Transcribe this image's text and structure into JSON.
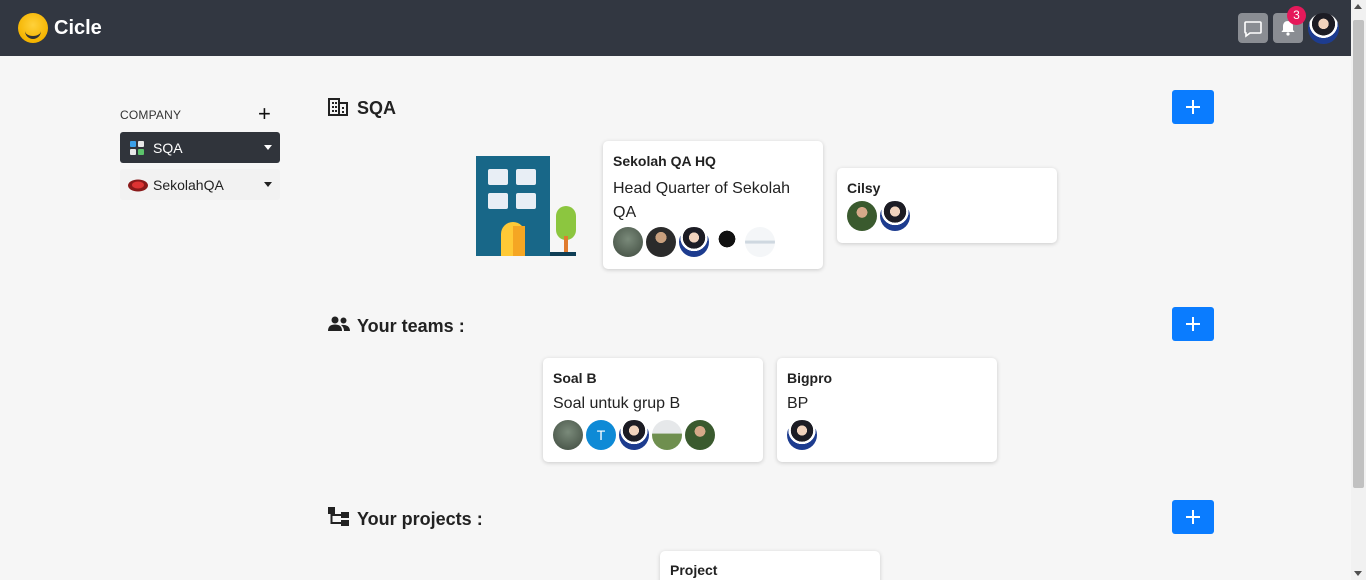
{
  "header": {
    "brand": "Cicle",
    "notification_count": "3"
  },
  "sidebar": {
    "company_label": "COMPANY",
    "add_symbol": "+",
    "companies": [
      {
        "name": "SQA",
        "active": true
      },
      {
        "name": "SekolahQA",
        "active": false
      }
    ]
  },
  "company_section": {
    "title": "SQA",
    "cards": [
      {
        "name": "Sekolah QA HQ",
        "description": "Head Quarter of Sekolah QA",
        "members": 5
      },
      {
        "name": "Cilsy",
        "description": "",
        "members": 2
      }
    ]
  },
  "teams_section": {
    "title": "Your teams :",
    "cards": [
      {
        "name": "Soal B",
        "description": "Soal untuk grup B",
        "members": 5,
        "initial_avatar": "T"
      },
      {
        "name": "Bigpro",
        "description": "BP",
        "members": 1
      }
    ]
  },
  "projects_section": {
    "title": "Your projects :",
    "cards": [
      {
        "name": "Project"
      }
    ]
  },
  "icons": {
    "chat": "chat-icon",
    "bell": "bell-icon",
    "building": "building-icon",
    "teams": "people-icon",
    "projects": "hierarchy-icon",
    "plus": "plus-icon"
  },
  "colors": {
    "topbar": "#323741",
    "accent": "#0a7cff",
    "badge": "#e5195a",
    "active_company": "#30343b"
  }
}
